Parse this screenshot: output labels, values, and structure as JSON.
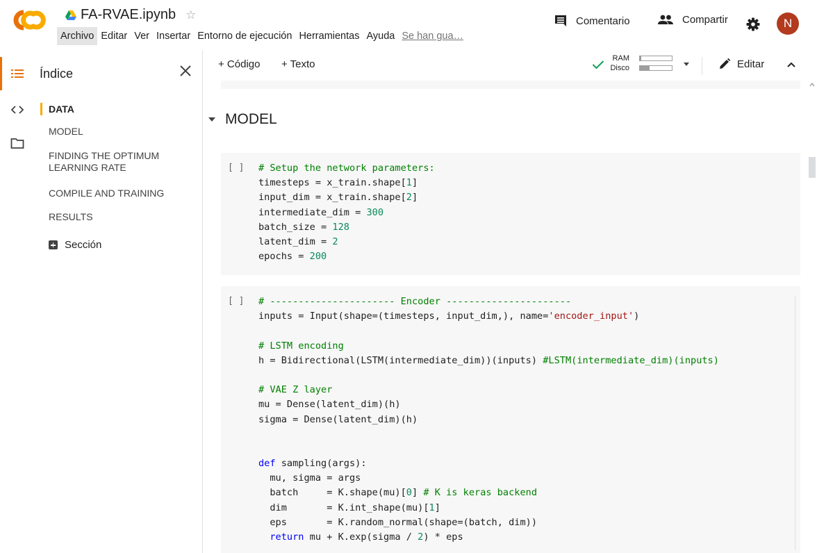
{
  "header": {
    "doc_title": "FA-RVAE.ipynb",
    "menu": [
      "Archivo",
      "Editar",
      "Ver",
      "Insertar",
      "Entorno de ejecución",
      "Herramientas",
      "Ayuda"
    ],
    "saved_status": "Se han gua…",
    "comment_label": "Comentario",
    "share_label": "Compartir",
    "avatar_letter": "N"
  },
  "sidebar": {
    "title": "Índice",
    "toc": [
      "DATA",
      "MODEL",
      "FINDING THE OPTIMUM LEARNING RATE",
      "COMPILE AND TRAINING",
      "RESULTS"
    ],
    "add_section": "Sección"
  },
  "toolbar": {
    "add_code": "+ Código",
    "add_text": "+ Texto",
    "ram_label": "RAM",
    "disk_label": "Disco",
    "ram_usage": 0.04,
    "disk_usage": 0.3,
    "edit_label": "Editar"
  },
  "notebook": {
    "heading": "MODEL",
    "run_indicator": "[ ]",
    "cell1_lines": [
      "# Setup the network parameters:",
      "timesteps = x_train.shape[1]",
      "input_dim = x_train.shape[2]",
      "intermediate_dim = 300",
      "batch_size = 128",
      "latent_dim = 2",
      "epochs = 200"
    ],
    "cell2_lines": [
      "# ---------------------- Encoder ----------------------",
      "inputs = Input(shape=(timesteps, input_dim,), name='encoder_input')",
      "",
      "# LSTM encoding",
      "h = Bidirectional(LSTM(intermediate_dim))(inputs) #LSTM(intermediate_dim)(inputs)",
      "",
      "# VAE Z layer",
      "mu = Dense(latent_dim)(h)",
      "sigma = Dense(latent_dim)(h)",
      "",
      "",
      "def sampling(args):",
      "  mu, sigma = args",
      "  batch     = K.shape(mu)[0] # K is keras backend",
      "  dim       = K.int_shape(mu)[1]",
      "  eps       = K.random_normal(shape=(batch, dim))",
      "  return mu + K.exp(sigma / 2) * eps"
    ]
  },
  "colors": {
    "accent": "#e8710a",
    "toc_marker": "#f9ab00",
    "avatar": "#b23a1e",
    "check": "#0f9d58",
    "comment": "#008000",
    "number": "#09885a",
    "string": "#a31515",
    "keyword": "#0000ff"
  }
}
